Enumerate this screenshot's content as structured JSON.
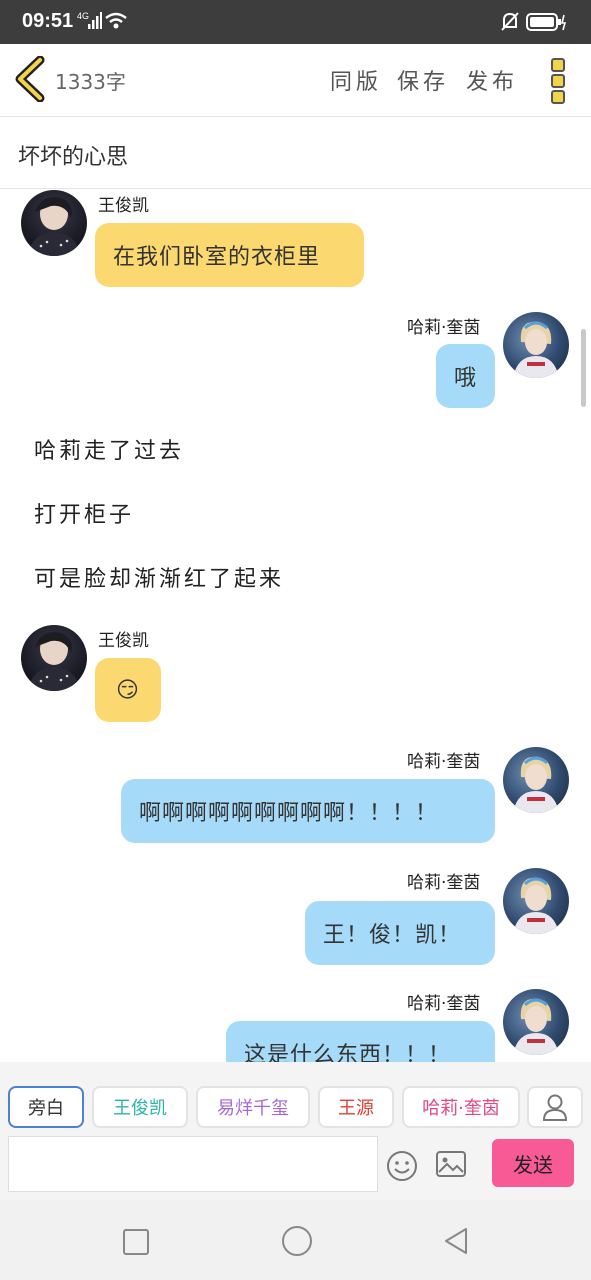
{
  "status": {
    "time": "09:51",
    "network": "4G"
  },
  "header": {
    "word_count": "1333字",
    "buttons": {
      "same": "同版",
      "save": "保存",
      "publish": "发布"
    }
  },
  "title": "坏坏的心思",
  "messages": [
    {
      "side": "left",
      "name": "王俊凯",
      "text": "在我们卧室的衣柜里",
      "color": "#fbd970"
    },
    {
      "side": "right",
      "name": "哈莉·奎茵",
      "text": "哦",
      "color": "#a6daf9"
    },
    {
      "side": "narration",
      "text": "哈莉走了过去"
    },
    {
      "side": "narration",
      "text": "打开柜子"
    },
    {
      "side": "narration",
      "text": "可是脸却渐渐红了起来"
    },
    {
      "side": "left",
      "name": "王俊凯",
      "text": "😏",
      "color": "#fbd970"
    },
    {
      "side": "right",
      "name": "哈莉·奎茵",
      "text": "啊啊啊啊啊啊啊啊啊！！！！",
      "color": "#a6daf9"
    },
    {
      "side": "right",
      "name": "哈莉·奎茵",
      "text": "王！俊！凯！",
      "color": "#a6daf9"
    },
    {
      "side": "right",
      "name": "哈莉·奎茵",
      "text": "这是什么东西！！！",
      "color": "#a6daf9"
    }
  ],
  "characters": [
    {
      "label": "旁白",
      "color": "#333333"
    },
    {
      "label": "王俊凯",
      "color": "#2bb5a6"
    },
    {
      "label": "易烊千玺",
      "color": "#a568d6"
    },
    {
      "label": "王源",
      "color": "#e0403a"
    },
    {
      "label": "哈莉·奎茵",
      "color": "#e04a8a"
    }
  ],
  "composer": {
    "send_label": "发送",
    "input_value": ""
  }
}
